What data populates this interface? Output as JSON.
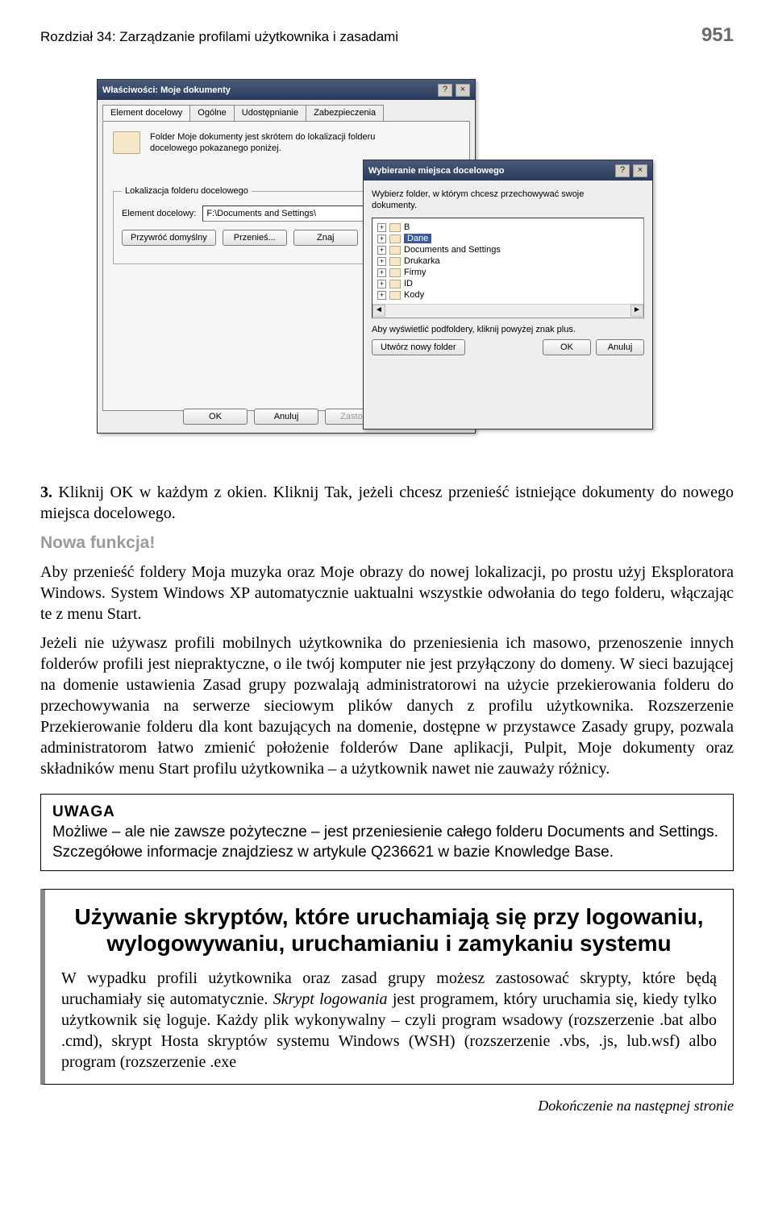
{
  "header": {
    "chapter": "Rozdział 34: Zarządzanie profilami użytkownika i zasadami",
    "page": "951"
  },
  "dialog1": {
    "title": "Właściwości: Moje dokumenty",
    "help": "?",
    "close": "×",
    "tabs": [
      "Element docelowy",
      "Ogólne",
      "Udostępnianie",
      "Zabezpieczenia"
    ],
    "desc1": "Folder Moje dokumenty jest skrótem do lokalizacji folderu",
    "desc2": "docelowego pokazanego poniżej.",
    "group_legend": "Lokalizacja folderu docelowego",
    "target_label": "Element docelowy:",
    "target_value": "F:\\Documents and Settings\\",
    "btn_restore": "Przywróć domyślny",
    "btn_move": "Przenieś...",
    "btn_find": "Znaj",
    "ok": "OK",
    "cancel": "Anuluj",
    "apply": "Zastosuj"
  },
  "dialog2": {
    "title": "Wybieranie miejsca docelowego",
    "help": "?",
    "close": "×",
    "instr1": "Wybierz folder, w którym chcesz przechowywać swoje",
    "instr2": "dokumenty.",
    "tree": [
      {
        "name": "B",
        "selected": false
      },
      {
        "name": "Dane",
        "selected": true
      },
      {
        "name": "Documents and Settings",
        "selected": false
      },
      {
        "name": "Drukarka",
        "selected": false
      },
      {
        "name": "Firmy",
        "selected": false
      },
      {
        "name": "ID",
        "selected": false
      },
      {
        "name": "Kody",
        "selected": false
      }
    ],
    "hint": "Aby wyświetlić podfoldery, kliknij powyżej znak plus.",
    "btn_new": "Utwórz nowy folder",
    "ok": "OK",
    "cancel": "Anuluj"
  },
  "body": {
    "step3_num": "3.",
    "step3_text": " Kliknij OK w każdym z okien. Kliknij Tak, jeżeli chcesz przenieść istniejące dokumenty do nowego miejsca docelowego.",
    "newfunc": "Nowa funkcja!",
    "para1": "Aby przenieść foldery Moja muzyka oraz Moje obrazy do nowej lokalizacji, po prostu użyj Eksploratora Windows. System Windows XP automatycznie uaktualni wszystkie odwołania do tego folderu, włączając te z menu Start.",
    "para2": "Jeżeli nie używasz profili mobilnych użytkownika do przeniesienia ich masowo, przenoszenie innych folderów profili jest niepraktyczne, o ile twój komputer nie jest przyłączony do domeny. W sieci bazującej na domenie ustawienia Zasad grupy pozwalają administratorowi na użycie przekierowania folderu do przechowywania na serwerze sieciowym plików danych z profilu użytkownika. Rozszerzenie Przekierowanie folderu dla kont bazujących na domenie, dostępne w przystawce Zasady grupy, pozwala administratorom łatwo zmienić położenie folderów Dane aplikacji, Pulpit, Moje dokumenty oraz składników menu Start profilu użytkownika – a użytkownik nawet nie zauważy różnicy.",
    "uwaga_title": "UWAGA",
    "uwaga_text": "Możliwe – ale nie zawsze pożyteczne – jest przeniesienie całego folderu Documents and Settings. Szczegółowe informacje znajdziesz w artykule Q236621 w bazie Knowledge Base.",
    "sidebar_title": "Używanie skryptów, które uruchamiają się przy logowaniu, wylogowywaniu, uruchamianiu i zamykaniu systemu",
    "sidebar_p1a": "W wypadku profili użytkownika oraz zasad grupy możesz zastosować skrypty, które będą uruchamiały się automatycznie. ",
    "sidebar_p1_em": "Skrypt logowania",
    "sidebar_p1b": " jest programem, który uruchamia się, kiedy tylko użytkownik się loguje. Każdy plik wykonywalny – czyli program wsadowy (rozszerzenie .bat albo .cmd), skrypt Hosta skryptów systemu Windows (WSH) (rozszerzenie .vbs, .js, lub.wsf) albo program (rozszerzenie .exe",
    "cont": "Dokończenie na następnej stronie"
  }
}
